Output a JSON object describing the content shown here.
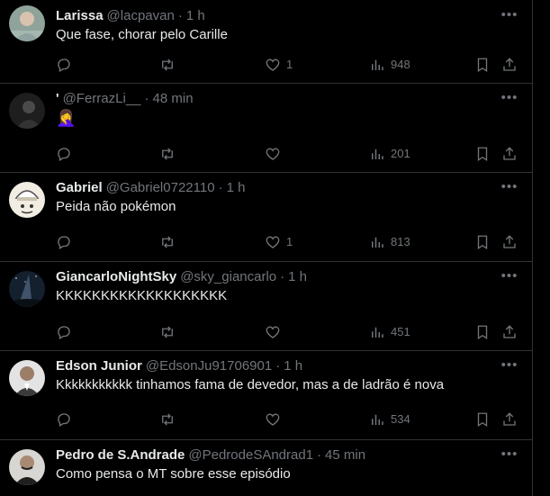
{
  "tweets": [
    {
      "name": "Larissa",
      "handle": "@lacpavan",
      "separator": "·",
      "time": "1 h",
      "text": "Que fase, chorar pelo Carille",
      "replies": "",
      "retweets": "",
      "likes": "1",
      "views": "948",
      "avatar_color": "#7a8c8a"
    },
    {
      "name": "'",
      "handle": "@FerrazLi__",
      "separator": "·",
      "time": "48 min",
      "text": "🤦‍♀️",
      "replies": "",
      "retweets": "",
      "likes": "",
      "views": "201",
      "avatar_color": "#2a2a2a"
    },
    {
      "name": "Gabriel",
      "handle": "@Gabriel0722110",
      "separator": "·",
      "time": "1 h",
      "text": "Peida não pokémon",
      "replies": "",
      "retweets": "",
      "likes": "1",
      "views": "813",
      "avatar_color": "#e8e4d8"
    },
    {
      "name": "GiancarloNightSky",
      "handle": "@sky_giancarlo",
      "separator": "·",
      "time": "1 h",
      "text": "KKKKKKKKKKKKKKKKKKK",
      "replies": "",
      "retweets": "",
      "likes": "",
      "views": "451",
      "avatar_color": "#1d2a3a"
    },
    {
      "name": "Edson Junior",
      "handle": "@EdsonJu91706901",
      "separator": "·",
      "time": "1 h",
      "text": "Kkkkkkkkkkk tinhamos fama de devedor, mas a de ladrão é nova",
      "replies": "",
      "retweets": "",
      "likes": "",
      "views": "534",
      "avatar_color": "#c9c9c9"
    },
    {
      "name": "Pedro de S.Andrade",
      "handle": "@PedrodeSAndrad1",
      "separator": "·",
      "time": "45 min",
      "text": "Como pensa o MT sobre esse episódio",
      "replies": "",
      "retweets": "",
      "likes": "",
      "views": "",
      "avatar_color": "#d0cfcc"
    }
  ],
  "icons": {
    "more": "more-icon",
    "reply": "reply-icon",
    "retweet": "retweet-icon",
    "like": "heart-icon",
    "views": "views-icon",
    "bookmark": "bookmark-icon",
    "share": "share-icon"
  },
  "colors": {
    "background": "#000000",
    "text": "#e7e9ea",
    "muted": "#71767b",
    "border": "#2f3336"
  }
}
